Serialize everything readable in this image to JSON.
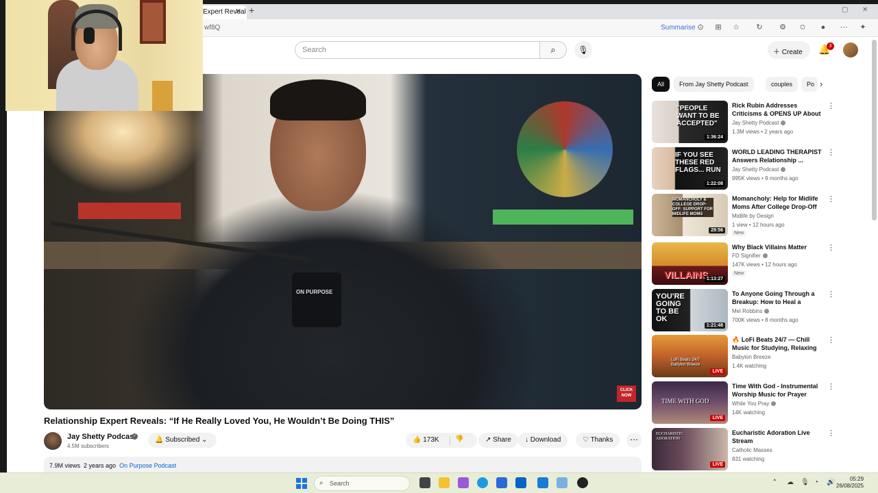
{
  "browser": {
    "tab_title": "Expert Reveal",
    "url_fragment": "wf8Q",
    "summarise_label": "Summarise"
  },
  "header": {
    "search_placeholder": "Search",
    "create_label": "Create",
    "notification_count": "3"
  },
  "video": {
    "title": "Relationship Expert Reveals: “If He Really Loved You, He Wouldn’t Be Doing THIS”",
    "mic_brand": "ON PURPOSE",
    "click_now_label": "CLICK NOW",
    "channel_name": "Jay Shetty Podcast",
    "subscribers": "4.5M subscribers",
    "subscribed_label": "Subscribed",
    "likes": "173K",
    "share_label": "Share",
    "download_label": "Download",
    "thanks_label": "Thanks",
    "views": "7.9M views",
    "age": "2 years ago",
    "desc_link": "On Purpose Podcast"
  },
  "sidebar": {
    "chips": [
      {
        "label": "All",
        "active": true
      },
      {
        "label": "From Jay Shetty Podcast",
        "active": false
      },
      {
        "label": "couples",
        "active": false
      },
      {
        "label": "Po",
        "active": false
      }
    ],
    "recommendations": [
      {
        "title": "Rick Rubin Addresses Criticisms & OPENS UP About ...",
        "channel": "Jay Shetty Podcast",
        "meta": "1.3M views • 2 years ago",
        "duration": "1:36:24",
        "thumb_text": "\"PEOPLE WANT TO BE ACCEPTED\"",
        "badge": ""
      },
      {
        "title": "WORLD LEADING THERAPIST Answers Relationship ...",
        "channel": "Jay Shetty Podcast",
        "meta": "995K views • 9 months ago",
        "duration": "1:22:08",
        "thumb_text": "IF YOU SEE THESE RED FLAGS... RUN",
        "badge": ""
      },
      {
        "title": "Momancholy: Help for Midlife Moms After College Drop-Off |...",
        "channel": "Midlife by Design",
        "meta": "1 view • 12 hours ago",
        "duration": "29:56",
        "thumb_text": "MOMANCHOLY & COLLEGE DROP-OFF: SUPPORT FOR MIDLIFE MOMS",
        "badge": "New"
      },
      {
        "title": "Why Black Villains Matter",
        "channel": "FD Signifier",
        "meta": "147K views • 12 hours ago",
        "duration": "1:13:27",
        "thumb_text": "VILLAINS",
        "badge": "New"
      },
      {
        "title": "To Anyone Going Through a Breakup: How to Heal a Broke...",
        "channel": "Mel Robbins",
        "meta": "700K views • 8 months ago",
        "duration": "1:21:48",
        "thumb_text": "YOU'RE GOING TO BE OK",
        "badge": ""
      },
      {
        "title": "LoFi Beats 24/7 — Chill Music for Studying, Relaxing &...",
        "channel": "Babylon Breeze",
        "meta": "1.4K watching",
        "duration": "LIVE",
        "thumb_text": "LoFi Beats 24/7 Babylon Breeze",
        "badge": ""
      },
      {
        "title": "Time With God - Instrumental Worship Music for Prayer",
        "channel": "While You Pray",
        "meta": "14K watching",
        "duration": "LIVE",
        "thumb_text": "TIME WITH GOD",
        "badge": ""
      },
      {
        "title": "Eucharistic Adoration Live Stream",
        "channel": "Catholic Masses",
        "meta": "831 watching",
        "duration": "LIVE",
        "thumb_text": "EUCHARISTIC ADORATION",
        "badge": ""
      }
    ]
  },
  "taskbar": {
    "search_placeholder": "Search",
    "time": "05:29",
    "date": "26/08/2025"
  }
}
